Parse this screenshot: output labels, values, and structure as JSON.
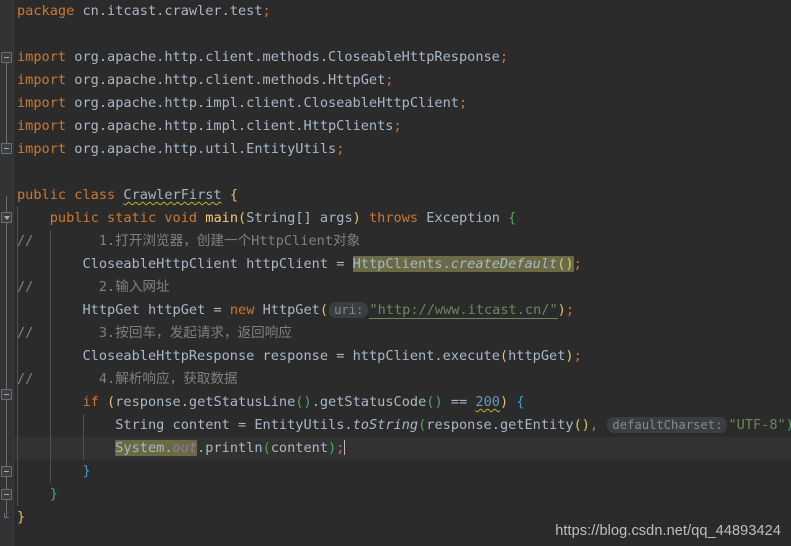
{
  "editor": {
    "theme": "darcula",
    "background": "#2B2B2B",
    "gutter_background": "#313335",
    "current_line_background": "#323232",
    "occurrence_highlight": "#6A6A45",
    "keyword_color": "#CC7832",
    "string_color": "#6A8759",
    "number_color": "#6897BB",
    "comment_color": "#808080",
    "method_color": "#FFC66D",
    "static_field_color": "#9876AA",
    "default_text_color": "#A9B7C6"
  },
  "code": {
    "package": {
      "keyword": "package",
      "name": " cn.itcast.crawler.test",
      "semicolon": ";"
    },
    "imports": [
      {
        "keyword": "import",
        "path": " org.apache.http.client.methods.CloseableHttpResponse",
        "semicolon": ";"
      },
      {
        "keyword": "import",
        "path": " org.apache.http.client.methods.HttpGet",
        "semicolon": ";"
      },
      {
        "keyword": "import",
        "path": " org.apache.http.impl.client.CloseableHttpClient",
        "semicolon": ";"
      },
      {
        "keyword": "import",
        "path": " org.apache.http.impl.client.HttpClients",
        "semicolon": ";"
      },
      {
        "keyword": "import",
        "path": " org.apache.http.util.EntityUtils",
        "semicolon": ";"
      }
    ],
    "class_decl": {
      "modifier": "public",
      "keyword": "class",
      "name": "CrawlerFirst",
      "brace": "{"
    },
    "method_decl": {
      "modifier": "public",
      "static": "static",
      "returns": "void",
      "name": "main",
      "paren_open": "(",
      "param_type": "String[]",
      "param_name": " args",
      "paren_close": ")",
      "throws": "throws",
      "exception": " Exception ",
      "brace": "{"
    },
    "comment_1": {
      "slashes": "//",
      "text": "1.打开浏览器，创建一个HttpClient对象"
    },
    "line_httpclient": {
      "type": "CloseableHttpClient",
      "var": " httpClient ",
      "eq": "= ",
      "highlight_class": "HttpClients",
      "dot": ".",
      "highlight_method": "createDefault",
      "parens": "()",
      "semicolon": ";"
    },
    "comment_2": {
      "slashes": "//",
      "text": "2.输入网址"
    },
    "line_httpget": {
      "type": "HttpGet",
      "var": " httpGet ",
      "eq": "= ",
      "new": "new",
      "ctor": " HttpGet",
      "paren_open": "(",
      "hint": "uri:",
      "url": "\"http://www.itcast.cn/\"",
      "paren_close": ")",
      "semicolon": ";"
    },
    "comment_3": {
      "slashes": "//",
      "text": "3.按回车，发起请求，返回响应"
    },
    "line_execute": {
      "type": "CloseableHttpResponse",
      "var": " response ",
      "eq": "= ",
      "receiver": "httpClient",
      "dot": ".",
      "method": "execute",
      "paren_open": "(",
      "arg": "httpGet",
      "paren_close": ")",
      "semicolon": ";"
    },
    "comment_4": {
      "slashes": "//",
      "text": "4.解析响应，获取数据"
    },
    "line_if": {
      "keyword": "if ",
      "paren_open": "(",
      "receiver": "response",
      "dot1": ".",
      "call1": "getStatusLine",
      "parens1": "()",
      "dot2": ".",
      "call2": "getStatusCode",
      "parens2": "()",
      "operator": " == ",
      "number": "200",
      "paren_close": ")",
      "brace": " {"
    },
    "line_tostring": {
      "type": "String",
      "var": " content ",
      "eq": "= ",
      "class": "EntityUtils",
      "dot": ".",
      "method": "toString",
      "paren_open": "(",
      "arg_receiver": "response",
      "arg_dot": ".",
      "arg_call": "getEntity",
      "arg_parens": "()",
      "comma": ", ",
      "hint": "defaultCharset:",
      "charset": "\"UTF-8\"",
      "paren_close": ")",
      "semicolon": ";"
    },
    "line_println": {
      "highlight_class": "System",
      "dot1": ".",
      "highlight_field": "out",
      "dot2": ".",
      "method": "println",
      "paren_open": "(",
      "arg": "content",
      "paren_close": ")",
      "semicolon": ";"
    },
    "brace_if_close": "}",
    "brace_method_close": "}",
    "brace_class_close": "}"
  },
  "watermark": {
    "text": "https://blog.csdn.net/qq_44893424"
  }
}
